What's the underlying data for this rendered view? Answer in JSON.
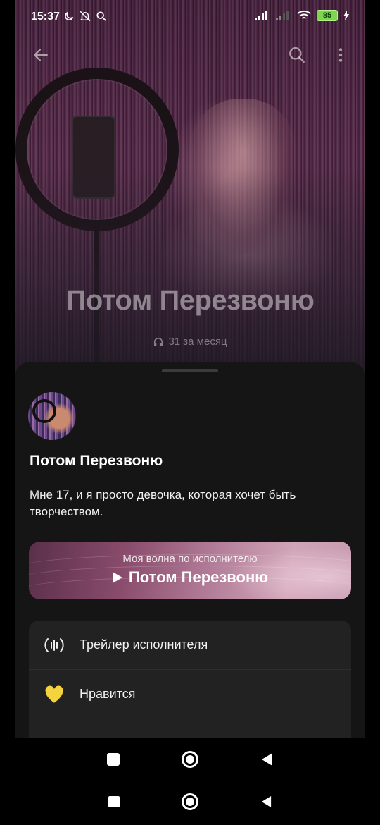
{
  "status_bar": {
    "time": "15:37",
    "battery": "85"
  },
  "header": {
    "back_icon": "arrow-left-icon",
    "search_icon": "search-icon",
    "more_icon": "more-vertical-icon"
  },
  "hero": {
    "title": "Потом Перезвоню",
    "listeners": "31 за месяц"
  },
  "artist": {
    "name": "Потом Перезвоню",
    "bio": "Мне 17, и я просто девочка, которая хочет быть творчеством."
  },
  "wave": {
    "label": "Моя волна по исполнителю",
    "title": "Потом Перезвоню"
  },
  "menu": {
    "items": [
      {
        "label": "Трейлер исполнителя",
        "icon": "audio-wave-icon"
      },
      {
        "label": "Нравится",
        "icon": "heart-icon",
        "icon_color": "#f5d33c"
      }
    ]
  },
  "colors": {
    "background": "#141414",
    "sheet": "#151515",
    "menu_bg": "#222222",
    "heart": "#f5d33c"
  }
}
